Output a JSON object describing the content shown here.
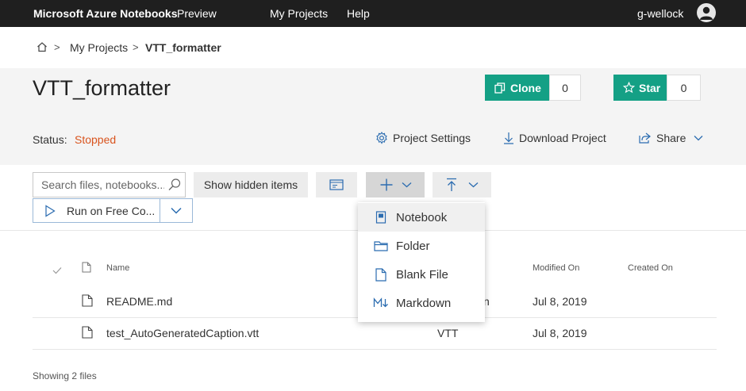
{
  "nav": {
    "brand": "Microsoft Azure Notebooks",
    "preview": "Preview",
    "my_projects": "My Projects",
    "help": "Help",
    "user": "g-wellock"
  },
  "breadcrumb": {
    "sep": ">",
    "my_projects": "My Projects",
    "current": "VTT_formatter"
  },
  "project": {
    "title": "VTT_formatter",
    "clone_label": "Clone",
    "clone_count": "0",
    "star_label": "Star",
    "star_count": "0",
    "status_label": "Status:",
    "status_value": "Stopped",
    "settings_label": "Project Settings",
    "download_label": "Download Project",
    "share_label": "Share"
  },
  "toolbar": {
    "search_placeholder": "Search files, notebooks...",
    "show_hidden": "Show hidden items",
    "run_label": "Run on Free Co..."
  },
  "menu": {
    "items": [
      {
        "label": "Notebook",
        "icon": "notebook-icon"
      },
      {
        "label": "Folder",
        "icon": "folder-icon"
      },
      {
        "label": "Blank File",
        "icon": "blank-file-icon"
      },
      {
        "label": "Markdown",
        "icon": "markdown-icon"
      }
    ]
  },
  "table": {
    "headers": {
      "name": "Name",
      "modified": "Modified On",
      "created": "Created On"
    },
    "rows": [
      {
        "name": "README.md",
        "type_partial": "n",
        "modified": "Jul 8, 2019"
      },
      {
        "name": "test_AutoGeneratedCaption.vtt",
        "type": "VTT",
        "modified": "Jul 8, 2019"
      }
    ],
    "footer": "Showing 2 files"
  },
  "colors": {
    "accent_green": "#14a085",
    "status_stopped": "#d9541e",
    "nav_bg": "#1f1f1f",
    "icon_blue": "#2b6cb0"
  }
}
